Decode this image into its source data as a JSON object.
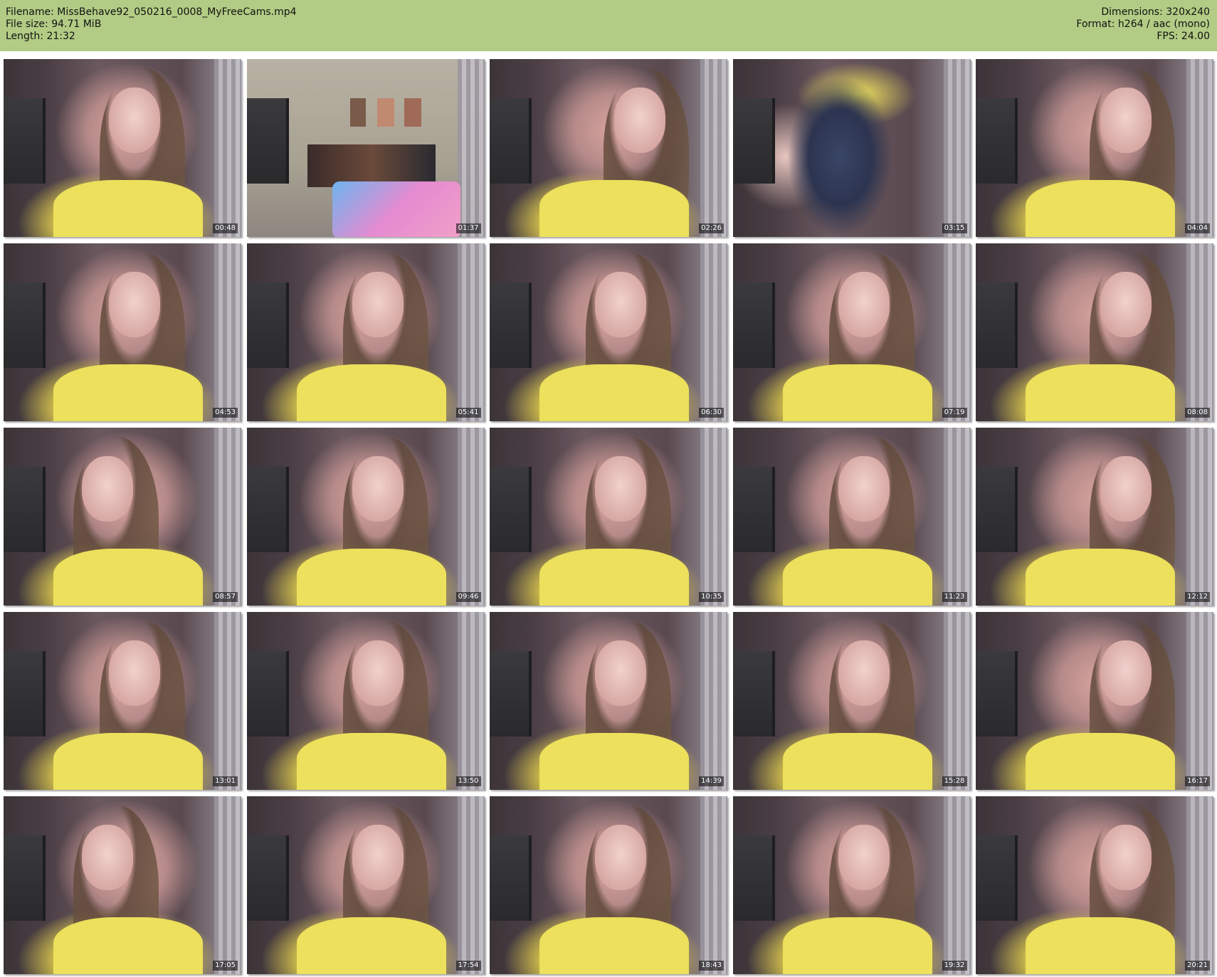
{
  "header": {
    "filename_label": "Filename: MissBehave92_050216_0008_MyFreeCams.mp4",
    "filesize_label": "File size: 94.71 MiB",
    "length_label": "Length: 21:32",
    "dimensions_label": "Dimensions: 320x240",
    "format_label": "Format: h264 / aac (mono)",
    "fps_label": "FPS: 24.00",
    "background_color": "#b2cc85"
  },
  "thumbnails": [
    {
      "timestamp": "00:48"
    },
    {
      "timestamp": "01:37"
    },
    {
      "timestamp": "02:26"
    },
    {
      "timestamp": "03:15"
    },
    {
      "timestamp": "04:04"
    },
    {
      "timestamp": "04:53"
    },
    {
      "timestamp": "05:41"
    },
    {
      "timestamp": "06:30"
    },
    {
      "timestamp": "07:19"
    },
    {
      "timestamp": "08:08"
    },
    {
      "timestamp": "08:57"
    },
    {
      "timestamp": "09:46"
    },
    {
      "timestamp": "10:35"
    },
    {
      "timestamp": "11:23"
    },
    {
      "timestamp": "12:12"
    },
    {
      "timestamp": "13:01"
    },
    {
      "timestamp": "13:50"
    },
    {
      "timestamp": "14:39"
    },
    {
      "timestamp": "15:28"
    },
    {
      "timestamp": "16:17"
    },
    {
      "timestamp": "17:05"
    },
    {
      "timestamp": "17:54"
    },
    {
      "timestamp": "18:43"
    },
    {
      "timestamp": "19:32"
    },
    {
      "timestamp": "20:21"
    }
  ]
}
